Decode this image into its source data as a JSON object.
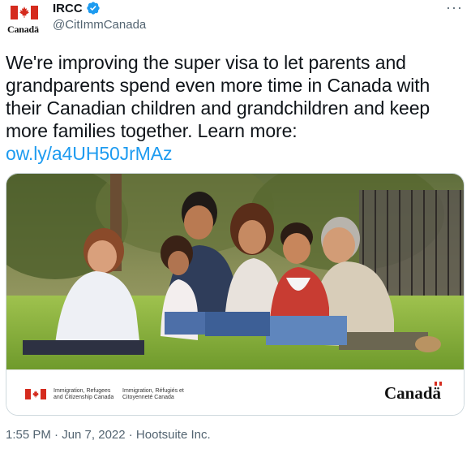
{
  "account": {
    "name": "IRCC",
    "handle": "@CitImmCanada",
    "avatar_wordmark": "Canadä"
  },
  "menu": {
    "more_label": "···"
  },
  "tweet": {
    "text": "We're improving the super visa to let parents and grandparents spend even more time in Canada with their Canadian children and grandchildren and keep more families together. Learn more: ",
    "link": "ow.ly/a4UH50JrMAz"
  },
  "media": {
    "banner_en": "Immigration, Refugees and Citizenship Canada",
    "banner_fr": "Immigration, Réfugiés et Citoyenneté Canada",
    "banner_wordmark": "Canadä"
  },
  "meta": {
    "timestamp": "1:55 PM · Jun 7, 2022 · Hootsuite Inc."
  },
  "colors": {
    "accent": "#1d9bf0",
    "flag_red": "#d52b1e",
    "muted_text": "#536471",
    "verified": "#1d9bf0"
  },
  "icons": [
    "canada-flag-icon",
    "verified-badge-icon",
    "more-icon"
  ]
}
